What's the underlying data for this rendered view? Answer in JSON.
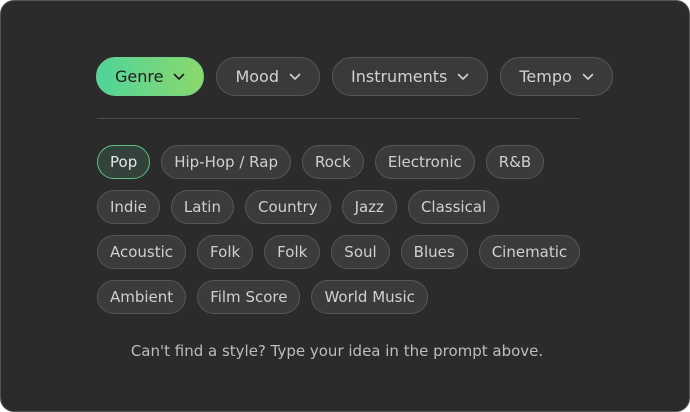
{
  "filters": [
    {
      "label": "Genre",
      "active": true
    },
    {
      "label": "Mood",
      "active": false
    },
    {
      "label": "Instruments",
      "active": false
    },
    {
      "label": "Tempo",
      "active": false
    }
  ],
  "chip_rows": [
    [
      "Pop",
      "Hip-Hop / Rap",
      "Rock",
      "Electronic",
      "R&B"
    ],
    [
      "Indie",
      "Latin",
      "Country",
      "Jazz",
      "Classical"
    ],
    [
      "Acoustic",
      "Folk",
      "Folk",
      "Soul",
      "Blues",
      "Cinematic"
    ],
    [
      "Ambient",
      "Film Score",
      "World Music"
    ]
  ],
  "selected_chip": "Pop",
  "hint": "Can't find a style? Type your idea in the prompt above.",
  "colors": {
    "panel_bg": "#2b2b2b",
    "accent_start": "#4fd49a",
    "accent_end": "#8cd86c",
    "selected_border": "#5fbf82"
  },
  "icons": {
    "dropdown": "chevron-down-icon"
  }
}
